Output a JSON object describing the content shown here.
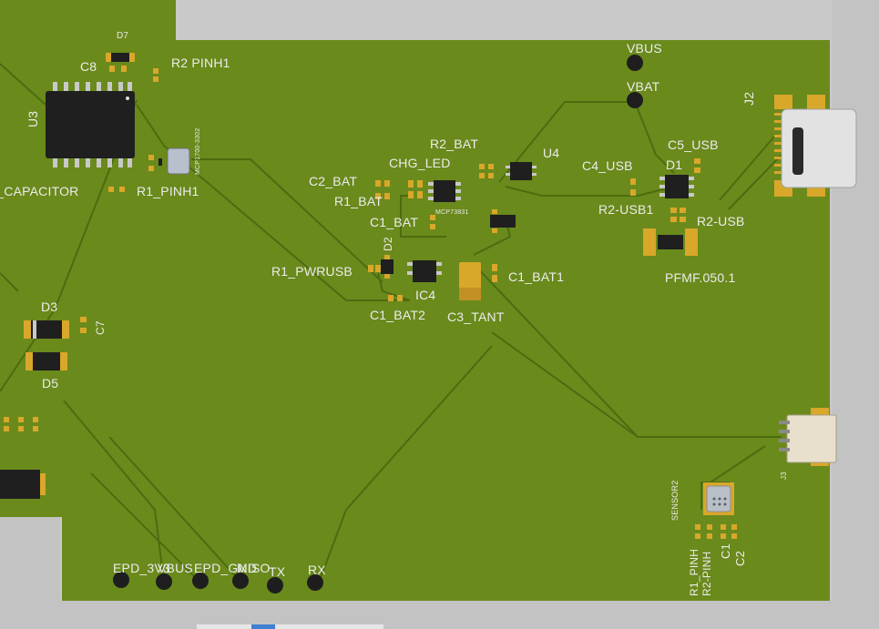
{
  "board": {
    "colors": {
      "background": "#c9c9c9",
      "pcb": "#6a8a1c",
      "trace": "#4d6d12",
      "pad": "#d9a72a",
      "ic": "#1f1f1f",
      "silk": "#ececec"
    }
  },
  "silkscreen": {
    "u3": "U3",
    "c8": "C8",
    "d7": "D7",
    "r2_pinh1": "R2 PINH1",
    "r_capacitor": "R_CAPACITOR",
    "r1_pinh1": "R1_PINH1",
    "vbus": "VBUS",
    "vbat": "VBAT",
    "j2": "J2",
    "r2_bat": "R2_BAT",
    "u4": "U4",
    "chg_led": "CHG_LED",
    "c2_bat": "C2_BAT",
    "r1_bat": "R1_BAT",
    "c1_bat": "C1_BAT",
    "c4_usb": "C4_USB",
    "c5_usb": "C5_USB",
    "d1": "D1",
    "r2_usb1": "R2-USB1",
    "r2_usb": "R2-USB",
    "pfmf": "PFMF.050.1",
    "d2": "D2",
    "r1_pwrusb": "R1_PWRUSB",
    "c1_bat1": "C1_BAT1",
    "ic4": "IC4",
    "c1_bat2": "C1_BAT2",
    "c3_tant": "C3_TANT",
    "d3": "D3",
    "c7": "C7",
    "d5": "D5",
    "j3": "J3",
    "sensor2": "SENSOR2",
    "r1_pinh": "R1_PINH",
    "r2_pinh": "R2-PINH",
    "c1": "C1",
    "c2": "C2",
    "epd_3v3": "EPD_3V3",
    "vbus_bottom": "VBUS",
    "epd_gnd": "EPD_GND",
    "miso": "MISO",
    "tx": "TX",
    "rx": "RX",
    "mic_mark": "MCP1700-3302",
    "tiny_mark": "MCP73831"
  }
}
